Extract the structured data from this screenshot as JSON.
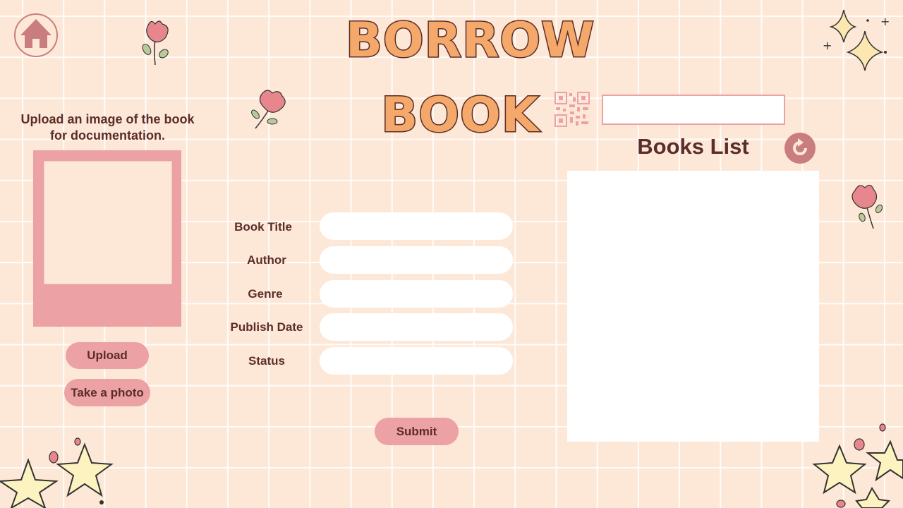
{
  "title": {
    "line1": "BORROW",
    "line2": "BOOK"
  },
  "nav": {
    "home_icon": "home-icon"
  },
  "upload_panel": {
    "caption": "Upload an image of the book for documentation.",
    "upload_label": "Upload",
    "take_photo_label": "Take a photo"
  },
  "form": {
    "fields": [
      {
        "label": "Book Title",
        "value": ""
      },
      {
        "label": "Author",
        "value": ""
      },
      {
        "label": "Genre",
        "value": ""
      },
      {
        "label": "Publish Date",
        "value": ""
      },
      {
        "label": "Status",
        "value": ""
      }
    ],
    "submit_label": "Submit"
  },
  "books_panel": {
    "search_value": "",
    "title": "Books List",
    "refresh_icon": "refresh-icon",
    "qr_icon": "qr-code-icon"
  },
  "colors": {
    "background": "#fde8d7",
    "accent_pink": "#eca1a4",
    "text_brown": "#5b2d2a",
    "title_orange": "#f4a86a"
  }
}
